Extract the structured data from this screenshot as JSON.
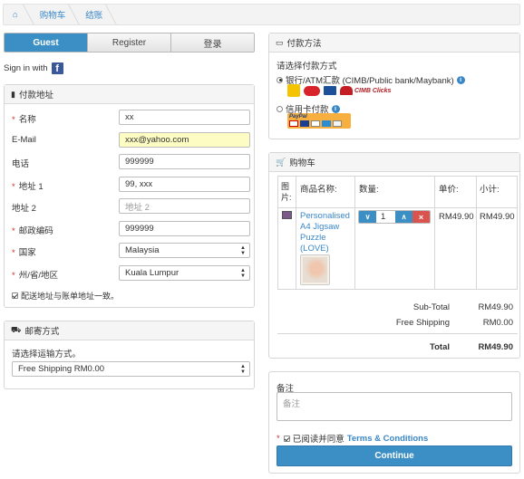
{
  "breadcrumb": {
    "items": [
      "购物车",
      "结账"
    ]
  },
  "tabs": [
    "Guest",
    "Register",
    "登录"
  ],
  "signin": {
    "text": "Sign in with"
  },
  "billing": {
    "title": "付款地址",
    "fields": [
      {
        "label": "名称",
        "required": true,
        "value": "xx",
        "placeholder": ""
      },
      {
        "label": "E-Mail",
        "required": false,
        "value": "xxx@yahoo.com",
        "placeholder": ""
      },
      {
        "label": "电话",
        "required": false,
        "value": "999999",
        "placeholder": ""
      },
      {
        "label": "地址 1",
        "required": true,
        "value": "99, xxx",
        "placeholder": ""
      },
      {
        "label": "地址 2",
        "required": false,
        "value": "",
        "placeholder": "地址 2"
      },
      {
        "label": "邮政编码",
        "required": true,
        "value": "999999",
        "placeholder": ""
      },
      {
        "label": "国家",
        "required": true,
        "value": "Malaysia",
        "placeholder": ""
      },
      {
        "label": "州/省/地区",
        "required": true,
        "value": "Kuala Lumpur",
        "placeholder": ""
      }
    ],
    "same_address": "配送地址与账单地址一致。"
  },
  "shipping": {
    "title": "邮寄方式",
    "prompt": "请选择运输方式。",
    "selected": "Free Shipping RM0.00"
  },
  "payment": {
    "title": "付款方法",
    "prompt": "请选择付款方式",
    "option1": "银行/ATM汇款 (CIMB/Public bank/Maybank)",
    "option2": "信用卡付款",
    "paypal": "PayPal",
    "cimb": "CIMB Clicks"
  },
  "cart": {
    "title": "购物车",
    "headers": [
      "图片:",
      "商品名称:",
      "数量:",
      "单价:",
      "小计:"
    ],
    "item": {
      "name": "Personalised A4 Jigsaw Puzzle (LOVE)",
      "qty": "1",
      "price": "RM49.90",
      "subtotal": "RM49.90"
    },
    "totals": [
      {
        "label": "Sub-Total",
        "value": "RM49.90"
      },
      {
        "label": "Free Shipping",
        "value": "RM0.00"
      },
      {
        "label": "Total",
        "value": "RM49.90"
      }
    ]
  },
  "notes": {
    "title": "备注",
    "placeholder": "备注",
    "agree_text": "已阅读并同意",
    "terms": "Terms & Conditions",
    "continue": "Continue"
  },
  "colors": {
    "accent": "#3c8fc4",
    "link": "#3a87c8",
    "danger": "#d9534f",
    "highlight": "#fdfcc3"
  }
}
